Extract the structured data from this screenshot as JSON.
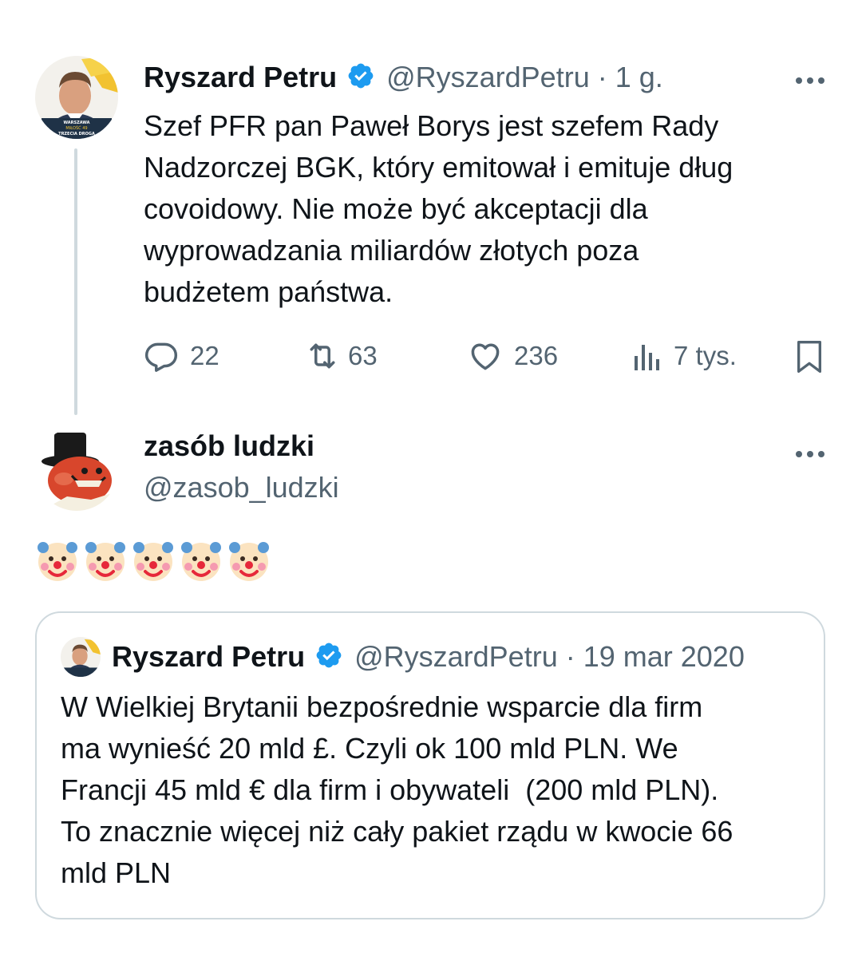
{
  "tweet": {
    "author_name": "Ryszard Petru",
    "author_handle": "@RyszardPetru",
    "time": "· 1 g.",
    "avatar_caption": [
      "WARSZAWA",
      "MIŁOŚĆ 49",
      "TRZECIA DROGA"
    ],
    "text": "Szef PFR pan Paweł Borys jest szefem Rady\nNadzorczej BGK, który emitował i emituje dług\ncovoidowy. Nie może być akceptacji dla\nwyprowadzania miliardów złotych poza\nbudżetem państwa.",
    "more_icon": "more-horizontal-icon",
    "actions": {
      "replies": "22",
      "reposts": "63",
      "likes": "236",
      "views": "7 tys."
    }
  },
  "reply": {
    "author_name": "zasób ludzki",
    "author_handle": "@zasob_ludzki",
    "emojis": [
      "🤡",
      "🤡",
      "🤡",
      "🤡",
      "🤡"
    ]
  },
  "quote": {
    "author_name": "Ryszard Petru",
    "author_handle": "@RyszardPetru",
    "date": "· 19 mar 2020",
    "text": "W Wielkiej Brytanii bezpośrednie wsparcie dla firm\nma wynieść 20 mld £. Czyli ok 100 mld PLN. We\nFrancji 45 mld € dla firm i obywateli  (200 mld PLN).\nTo znacznie więcej niż cały pakiet rządu w kwocie 66\nmld PLN"
  },
  "colors": {
    "text": "#0f1419",
    "secondary": "#536471",
    "verified": "#1d9bf0",
    "border": "#cfd9de"
  }
}
